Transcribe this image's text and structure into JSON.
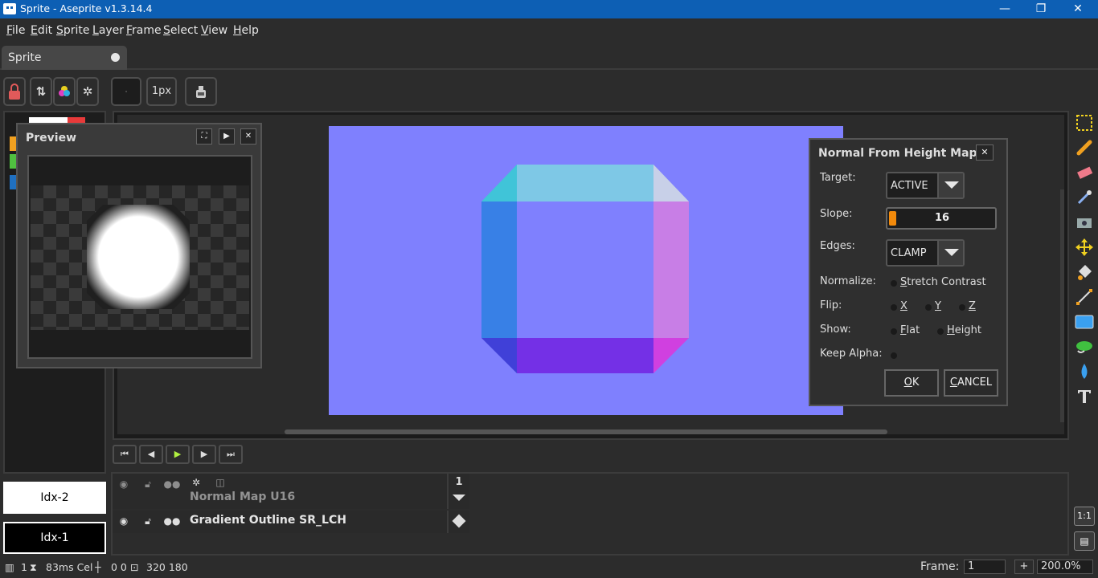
{
  "window": {
    "title": "Sprite - Aseprite v1.3.14.4",
    "minimize": "—",
    "maximize": "❐",
    "close": "✕"
  },
  "menu": [
    "File",
    "Edit",
    "Sprite",
    "Layer",
    "Frame",
    "Select",
    "View",
    "Help"
  ],
  "tab": {
    "label": "Sprite"
  },
  "toolbar": {
    "brush_size": "1px"
  },
  "preview": {
    "title": "Preview"
  },
  "dialog": {
    "title": "Normal From Height Map",
    "target_label": "Target:",
    "target_value": "ACTIVE",
    "slope_label": "Slope:",
    "slope_value": "16",
    "slope_fraction": 0.06,
    "edges_label": "Edges:",
    "edges_value": "CLAMP",
    "normalize_label": "Normalize:",
    "normalize_option": "Stretch Contrast",
    "flip_label": "Flip:",
    "flip_x": "X",
    "flip_y": "Y",
    "flip_z": "Z",
    "show_label": "Show:",
    "show_flat": "Flat",
    "show_height": "Height",
    "keep_alpha_label": "Keep Alpha:",
    "ok": "OK",
    "cancel": "CANCEL"
  },
  "colors": {
    "foreground": "Idx-2",
    "background": "Idx-1",
    "canvas_bg": "#7f80fe",
    "accent": "#f28a0b"
  },
  "timeline": {
    "frame_header": "1",
    "layers": [
      {
        "name": "Normal Map U16"
      },
      {
        "name": "Gradient Outline SR_LCH"
      }
    ]
  },
  "status": {
    "frame_num": "1",
    "duration": "83ms Cel",
    "position": "0 0",
    "size": "320 180",
    "frame_label": "Frame:",
    "frame_value": "1",
    "add": "+",
    "zoom": "200.0%"
  }
}
